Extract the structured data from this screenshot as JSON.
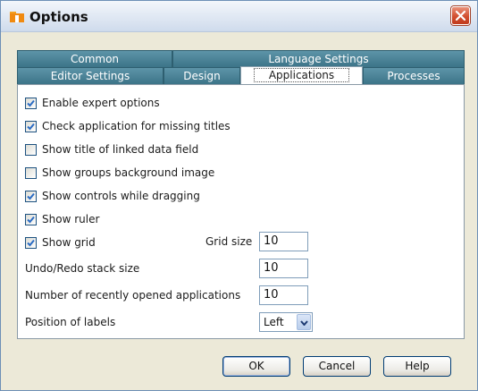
{
  "window": {
    "title": "Options",
    "icon": "folder-app-icon",
    "close_icon": "close-icon"
  },
  "tabs": {
    "back_row": [
      "Common",
      "Language Settings"
    ],
    "front_row": [
      "Editor Settings",
      "Design",
      "Applications",
      "Processes"
    ],
    "active": "Applications"
  },
  "options": [
    {
      "label": "Enable expert options",
      "checked": true
    },
    {
      "label": "Check application for missing titles",
      "checked": true
    },
    {
      "label": "Show title of linked data field",
      "checked": false
    },
    {
      "label": "Show groups background image",
      "checked": false
    },
    {
      "label": "Show controls while dragging",
      "checked": true
    },
    {
      "label": "Show ruler",
      "checked": true
    },
    {
      "label": "Show grid",
      "checked": true
    }
  ],
  "grid_size": {
    "label": "Grid size",
    "value": "10"
  },
  "undo_redo": {
    "label": "Undo/Redo stack size",
    "value": "10"
  },
  "recent_apps": {
    "label": "Number of recently opened applications",
    "value": "10"
  },
  "label_position": {
    "label": "Position of labels",
    "value": "Left"
  },
  "buttons": {
    "ok": "OK",
    "cancel": "Cancel",
    "help": "Help"
  },
  "colors": {
    "tab_fill": "#3c7488",
    "close_button": "#d24f2f",
    "checkbox_check": "#2b6cc4"
  }
}
